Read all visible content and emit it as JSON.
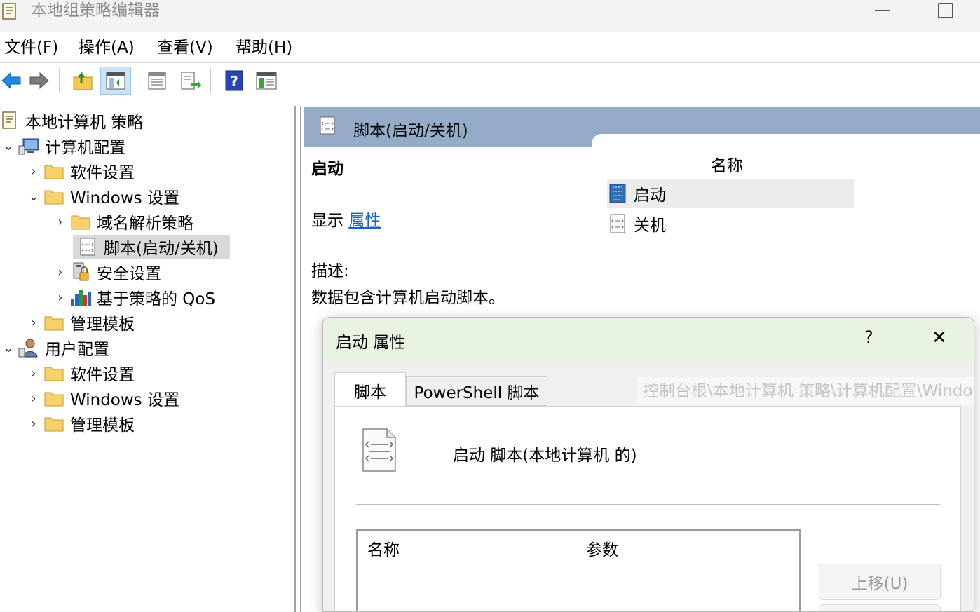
{
  "window": {
    "title": "本地组策略编辑器"
  },
  "menu": {
    "file": "文件(F)",
    "action": "操作(A)",
    "view": "查看(V)",
    "help": "帮助(H)"
  },
  "toolbar": {
    "buttons": [
      "back-arrow-icon",
      "forward-arrow-icon",
      "up-folder-icon",
      "show-hide-tree-icon",
      "properties-icon",
      "export-list-icon",
      "help-icon",
      "extended-view-icon"
    ]
  },
  "tree": {
    "root": "本地计算机 策略",
    "computer_config": "计算机配置",
    "software_settings": "软件设置",
    "windows_settings": "Windows 设置",
    "dns_policy": "域名解析策略",
    "scripts": "脚本(启动/关机)",
    "security_settings": "安全设置",
    "qos": "基于策略的 QoS",
    "admin_templates": "管理模板",
    "user_config": "用户配置",
    "user_software_settings": "软件设置",
    "user_windows_settings": "Windows 设置",
    "user_admin_templates": "管理模板"
  },
  "right": {
    "header_title": "脚本(启动/关机)",
    "item_heading": "启动",
    "show_label": "显示",
    "properties_link": "属性",
    "description_label": "描述:",
    "description_text": "数据包含计算机启动脚本。",
    "list_header": "名称",
    "items": [
      "启动",
      "关机"
    ]
  },
  "dialog": {
    "title": "启动 属性",
    "help": "?",
    "close": "✕",
    "tabs": [
      "脚本",
      "PowerShell 脚本"
    ],
    "tooltip_path": "控制台根\\本地计算机 策略\\计算机配置\\Windows 设置\\脚本(启动/关机)",
    "script_caption": "启动 脚本(本地计算机 的)",
    "columns": {
      "name": "名称",
      "params": "参数"
    },
    "move_up": "上移(U)"
  }
}
